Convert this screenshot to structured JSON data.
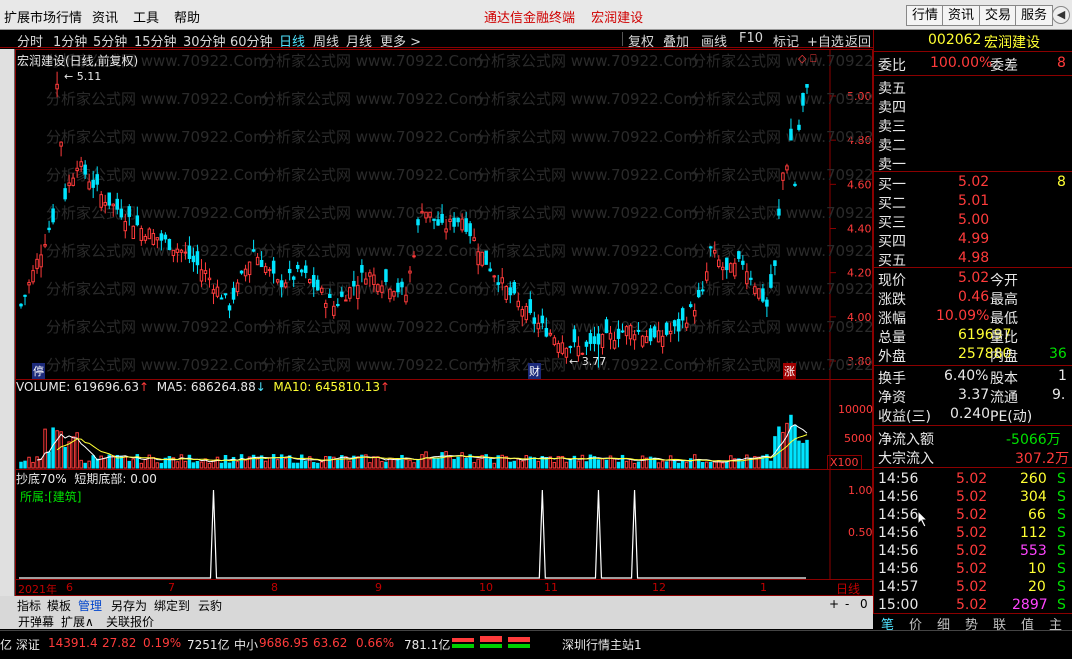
{
  "menubar": {
    "items": [
      "扩展市场行情",
      "资讯",
      "工具",
      "帮助"
    ],
    "center_items": [
      "通达信金融终端",
      "宏润建设"
    ],
    "right_buttons": [
      "行情",
      "资讯",
      "交易",
      "服务"
    ]
  },
  "periods": {
    "items": [
      "分时",
      "1分钟",
      "5分钟",
      "15分钟",
      "30分钟",
      "60分钟",
      "日线",
      "周线",
      "月线",
      "更多 >"
    ],
    "active": "日线",
    "right_items": [
      "复权",
      "叠加",
      "画线",
      "F10",
      "标记",
      "+自选",
      "返回"
    ]
  },
  "main_chart": {
    "title": "宏润建设(日线,前复权)",
    "high_label": "5.11",
    "low_label": "3.77",
    "price_ticks": [
      "5.00",
      "4.80",
      "4.60",
      "4.40",
      "4.20",
      "4.00",
      "3.80"
    ],
    "markers": [
      "停",
      "财",
      "涨"
    ],
    "watermark": "分析家公式网 www.70922.Com"
  },
  "volume": {
    "label": "VOLUME:",
    "value": "619696.63",
    "ma5_label": "MA5:",
    "ma5": "686264.88",
    "ma10_label": "MA10:",
    "ma10": "645810.13",
    "ticks": [
      "10000",
      "5000"
    ],
    "unit": "X100"
  },
  "indicator": {
    "title": "抄底70%",
    "param_label": "短期底部:",
    "param_value": "0.00",
    "sector": "所属:[建筑]",
    "ticks": [
      "1.00",
      "0.50"
    ]
  },
  "dates": {
    "items": [
      "2021年",
      "6",
      "7",
      "8",
      "9",
      "10",
      "11",
      "12",
      "1"
    ],
    "period": "日线",
    "controls": [
      "+",
      "-",
      "0"
    ]
  },
  "tabs_row1": [
    "指标",
    "模板",
    "管理",
    "另存为",
    "绑定到",
    "云豹"
  ],
  "tabs_row2": [
    "开弹幕",
    "扩展∧",
    "关联报价"
  ],
  "status": {
    "idx1_name": "亿 深证",
    "idx1_value": "14391.4",
    "idx1_change": "27.82",
    "idx1_pct": "0.19%",
    "idx1_amt": "7251亿",
    "idx2_name": "中小",
    "idx2_value": "9686.95",
    "idx2_change": "63.62",
    "idx2_pct": "0.66%",
    "idx2_amt": "781.1亿",
    "server": "深圳行情主站1"
  },
  "quote": {
    "code": "002062",
    "name": "宏润建设",
    "webi_label": "委比",
    "webi": "100.00%",
    "weicha_label": "委差",
    "weicha": "8",
    "sells": [
      "卖五",
      "卖四",
      "卖三",
      "卖二",
      "卖一"
    ],
    "buys": [
      {
        "label": "买一",
        "price": "5.02",
        "vol": "8"
      },
      {
        "label": "买二",
        "price": "5.01",
        "vol": ""
      },
      {
        "label": "买三",
        "price": "5.00",
        "vol": ""
      },
      {
        "label": "买四",
        "price": "4.99",
        "vol": ""
      },
      {
        "label": "买五",
        "price": "4.98",
        "vol": ""
      }
    ],
    "stats": [
      {
        "l1": "现价",
        "v1": "5.02",
        "l2": "今开",
        "v2": ""
      },
      {
        "l1": "涨跌",
        "v1": "0.46",
        "l2": "最高",
        "v2": ""
      },
      {
        "l1": "涨幅",
        "v1": "10.09%",
        "l2": "最低",
        "v2": ""
      },
      {
        "l1": "总量",
        "v1": "619697",
        "l2": "量比",
        "v2": ""
      },
      {
        "l1": "外盘",
        "v1": "257880",
        "l2": "内盘",
        "v2": "36"
      }
    ],
    "stats2": [
      {
        "l1": "换手",
        "v1": "6.40%",
        "l2": "股本",
        "v2": "1"
      },
      {
        "l1": "净资",
        "v1": "3.37",
        "l2": "流通",
        "v2": "9."
      },
      {
        "l1": "收益(三)",
        "v1": "0.240",
        "l2": "PE(动)",
        "v2": ""
      }
    ],
    "flow_net_label": "净流入额",
    "flow_net": "-5066万",
    "flow_big_label": "大宗流入",
    "flow_big": "307.2万",
    "ticks": [
      {
        "time": "14:56",
        "price": "5.02",
        "vol": "260"
      },
      {
        "time": "14:56",
        "price": "5.02",
        "vol": "304"
      },
      {
        "time": "14:56",
        "price": "5.02",
        "vol": "66"
      },
      {
        "time": "14:56",
        "price": "5.02",
        "vol": "112"
      },
      {
        "time": "14:56",
        "price": "5.02",
        "vol": "553"
      },
      {
        "time": "14:56",
        "price": "5.02",
        "vol": "10"
      },
      {
        "time": "14:57",
        "price": "5.02",
        "vol": "20"
      },
      {
        "time": "15:00",
        "price": "5.02",
        "vol": "2897"
      }
    ],
    "tick_flags": [
      "S",
      "S",
      "S",
      "S",
      "S",
      "S",
      "S",
      "S"
    ],
    "bottom_tabs": [
      "笔",
      "价",
      "细",
      "势",
      "联",
      "值",
      "主"
    ]
  },
  "colors": {
    "up": "#ff3b3b",
    "down": "#00e5ff",
    "ma5": "#ffffff",
    "ma10": "#ffff33",
    "border": "#8b0000"
  }
}
